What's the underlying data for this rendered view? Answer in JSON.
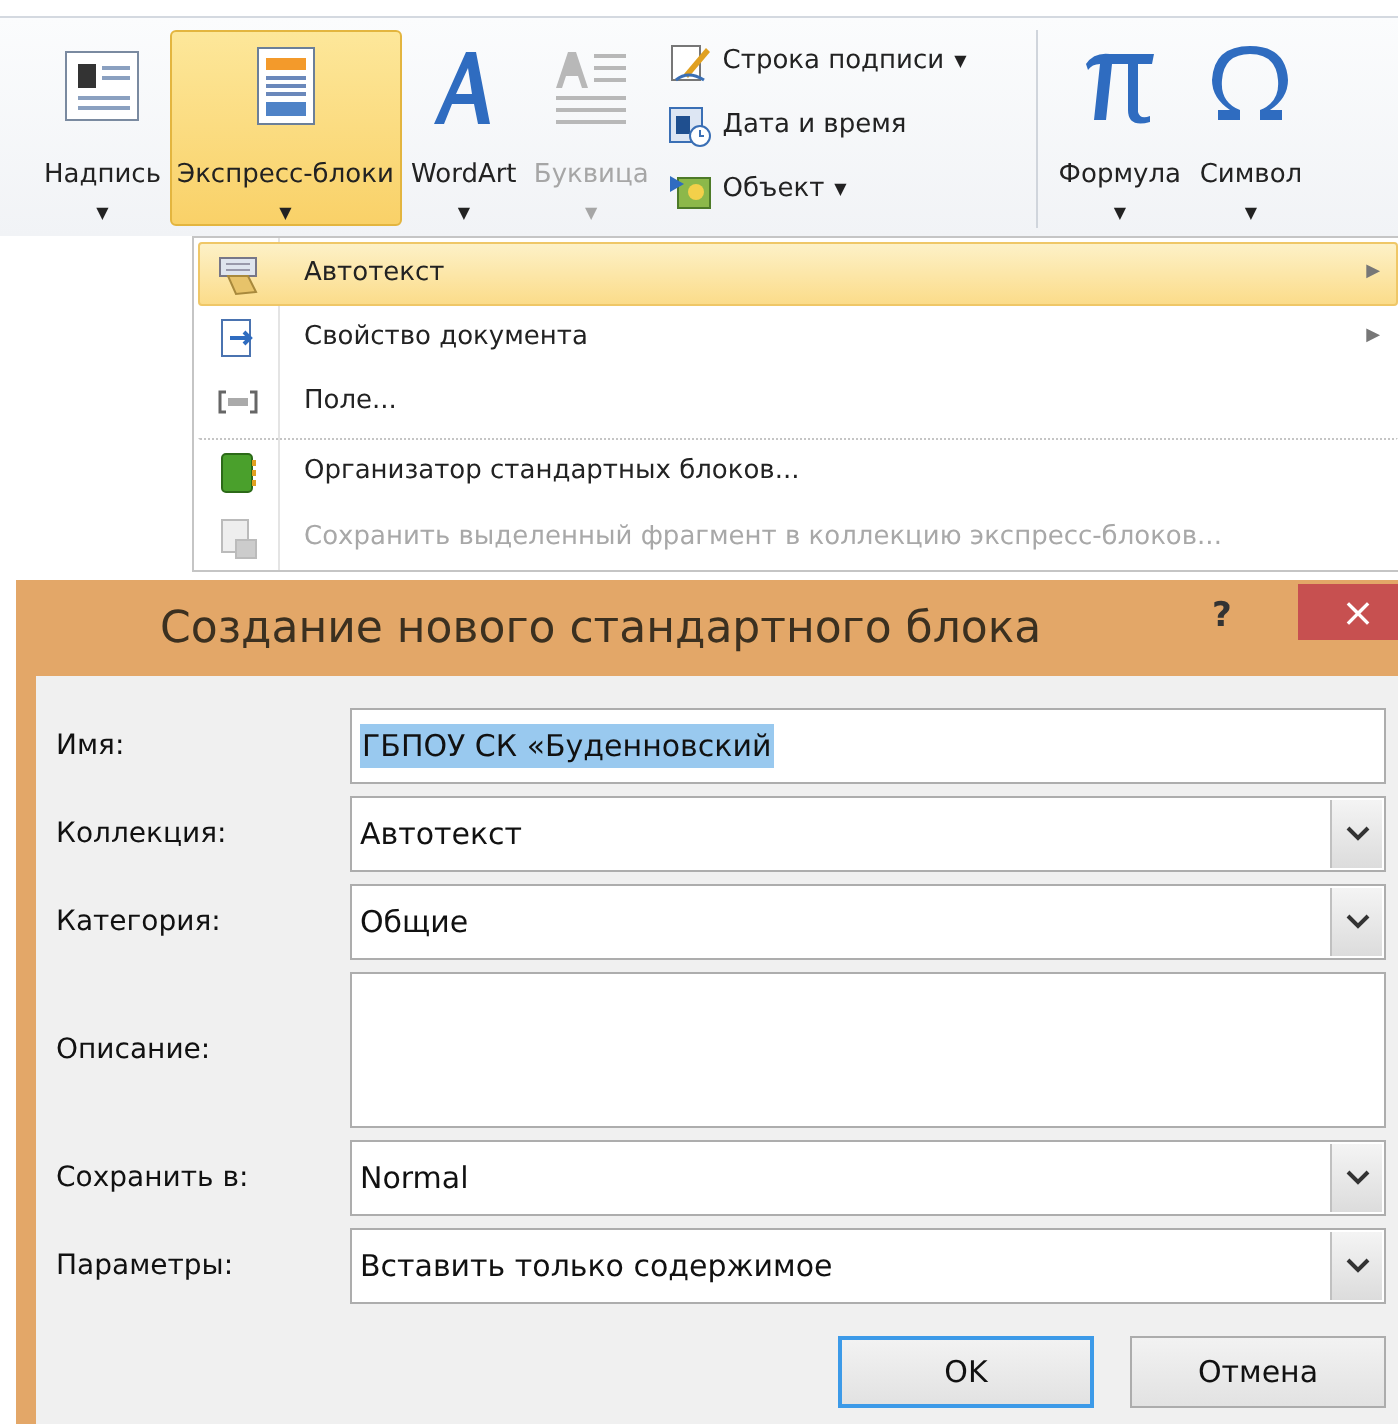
{
  "ribbon": {
    "items": [
      {
        "kind": "large",
        "label": "Надпись",
        "caret": "▼",
        "selected": false,
        "disabled": false
      },
      {
        "kind": "large",
        "label": "Экспресс-блоки",
        "caret": "▼",
        "selected": true,
        "disabled": false
      },
      {
        "kind": "large",
        "label": "WordArt",
        "caret": "▼",
        "selected": false,
        "disabled": false
      },
      {
        "kind": "large",
        "label": "Буквица",
        "caret": "▼",
        "selected": false,
        "disabled": true
      },
      {
        "kind": "smallgroup",
        "entries": [
          {
            "label": "Строка подписи",
            "caret": "▼"
          },
          {
            "label": "Дата и время"
          },
          {
            "label": "Объект",
            "caret": "▼"
          }
        ]
      },
      {
        "kind": "separator"
      },
      {
        "kind": "large",
        "label": "Формула",
        "caret": "▼",
        "selected": false,
        "disabled": false
      },
      {
        "kind": "large",
        "label": "Символ",
        "caret": "▼",
        "selected": false,
        "disabled": false
      }
    ]
  },
  "menu": {
    "items": [
      {
        "label": "Автотекст",
        "arrow": "▶",
        "selected": true,
        "disabled": false,
        "separator_before": false
      },
      {
        "label": "Свойство документа",
        "arrow": "▶",
        "selected": false,
        "disabled": false,
        "separator_before": false
      },
      {
        "label": "Поле...",
        "selected": false,
        "disabled": false,
        "separator_before": false
      },
      {
        "label": "Организатор стандартных блоков...",
        "selected": false,
        "disabled": false,
        "separator_before": true
      },
      {
        "label": "Сохранить выделенный фрагмент в коллекцию экспресс-блоков...",
        "selected": false,
        "disabled": true,
        "separator_before": false
      }
    ]
  },
  "dialog": {
    "title": "Создание нового стандартного блока",
    "help": "?",
    "close": "×",
    "fields": [
      {
        "kind": "text",
        "label": "Имя:",
        "value": "ГБПОУ СК «Буденновский",
        "text_selected": true
      },
      {
        "kind": "combo",
        "label": "Коллекция:",
        "value": "Автотекст"
      },
      {
        "kind": "combo",
        "label": "Категория:",
        "value": "Общие"
      },
      {
        "kind": "textarea",
        "label": "Описание:"
      },
      {
        "kind": "combo",
        "label": "Сохранить в:",
        "value": "Normal"
      },
      {
        "kind": "combo",
        "label": "Параметры:",
        "value": "Вставить только содержимое"
      }
    ],
    "buttons": [
      {
        "label": "OK",
        "default": true
      },
      {
        "label": "Отмена",
        "default": false
      }
    ]
  }
}
